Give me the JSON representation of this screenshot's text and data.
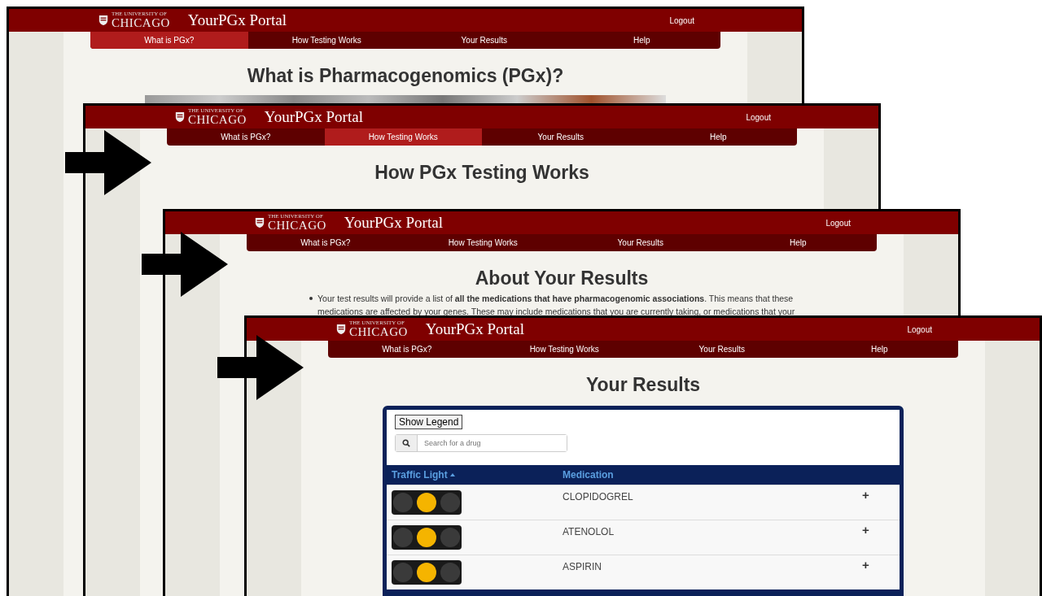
{
  "windows": [
    {
      "kind": "intro",
      "logo": {
        "small_line": "THE UNIVERSITY OF",
        "big_line": "CHICAGO"
      },
      "portal_title": "YourPGx Portal",
      "logout": "Logout",
      "nav": [
        {
          "label": "What is PGx?",
          "selected": true
        },
        {
          "label": "How Testing Works",
          "selected": false
        },
        {
          "label": "Your Results",
          "selected": false
        },
        {
          "label": "Help",
          "selected": false
        }
      ],
      "heading": "What is Pharmacogenomics (PGx)?"
    },
    {
      "kind": "plain",
      "logo": {
        "small_line": "THE UNIVERSITY OF",
        "big_line": "CHICAGO"
      },
      "portal_title": "YourPGx Portal",
      "logout": "Logout",
      "nav": [
        {
          "label": "What is PGx?",
          "selected": false
        },
        {
          "label": "How Testing Works",
          "selected": true
        },
        {
          "label": "Your Results",
          "selected": false
        },
        {
          "label": "Help",
          "selected": false
        }
      ],
      "heading": "How PGx Testing Works"
    },
    {
      "kind": "text",
      "logo": {
        "small_line": "THE UNIVERSITY OF",
        "big_line": "CHICAGO"
      },
      "portal_title": "YourPGx Portal",
      "logout": "Logout",
      "nav": [
        {
          "label": "What is PGx?",
          "selected": false
        },
        {
          "label": "How Testing Works",
          "selected": false
        },
        {
          "label": "Your Results",
          "selected": false
        },
        {
          "label": "Help",
          "selected": false
        }
      ],
      "heading": "About Your Results",
      "bullet": "Your test results will provide a list of **all the medications that have pharmacogenomic associations**. This means that these medications are affected by your genes. These may include medications that you are currently taking, or medications that your"
    },
    {
      "kind": "results",
      "logo": {
        "small_line": "THE UNIVERSITY OF",
        "big_line": "CHICAGO"
      },
      "portal_title": "YourPGx Portal",
      "logout": "Logout",
      "nav": [
        {
          "label": "What is PGx?",
          "selected": false
        },
        {
          "label": "How Testing Works",
          "selected": false
        },
        {
          "label": "Your Results",
          "selected": false
        },
        {
          "label": "Help",
          "selected": false
        }
      ],
      "heading": "Your Results",
      "results": {
        "legend_button": "Show Legend",
        "search": {
          "placeholder": "Search for a drug"
        },
        "columns": [
          "Traffic Light",
          "Medication"
        ],
        "rows": [
          {
            "color": "#f5b400",
            "medication": "CLOPIDOGREL",
            "expand": "+"
          },
          {
            "color": "#f5b400",
            "medication": "ATENOLOL",
            "expand": "+"
          },
          {
            "color": "#f5b400",
            "medication": "ASPIRIN",
            "expand": "+"
          }
        ]
      }
    }
  ]
}
